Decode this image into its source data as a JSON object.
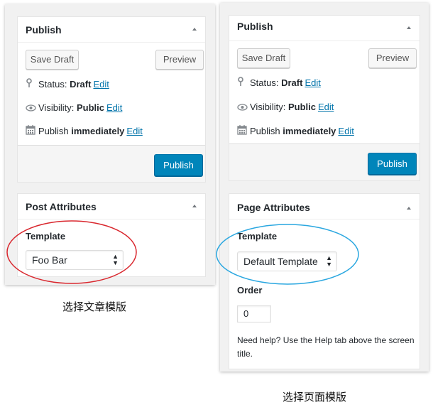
{
  "left": {
    "publish_box": {
      "title": "Publish",
      "save_draft": "Save Draft",
      "preview": "Preview",
      "status_label": "Status:",
      "status_value": "Draft",
      "visibility_label": "Visibility:",
      "visibility_value": "Public",
      "publish_label": "Publish",
      "publish_value": "immediately",
      "edit": "Edit",
      "publish_button": "Publish"
    },
    "attributes_box": {
      "title": "Post Attributes",
      "template_label": "Template",
      "template_value": "Foo Bar"
    },
    "caption": "选择文章模版"
  },
  "right": {
    "publish_box": {
      "title": "Publish",
      "save_draft": "Save Draft",
      "preview": "Preview",
      "status_label": "Status:",
      "status_value": "Draft",
      "visibility_label": "Visibility:",
      "visibility_value": "Public",
      "publish_label": "Publish",
      "publish_value": "immediately",
      "edit": "Edit",
      "publish_button": "Publish"
    },
    "attributes_box": {
      "title": "Page Attributes",
      "template_label": "Template",
      "template_value": "Default Template",
      "order_label": "Order",
      "order_value": "0",
      "help_text": "Need help? Use the Help tab above the screen title."
    },
    "caption": "选择页面模版"
  },
  "colors": {
    "primary_button": "#0085ba",
    "link": "#0073aa",
    "highlight_red": "#d9272e",
    "highlight_blue": "#2aa7e0"
  },
  "icons": {
    "status": "pin-icon",
    "visibility": "eye-icon",
    "publish": "calendar-icon",
    "collapse": "triangle-up-icon",
    "select": "select-arrows-icon"
  }
}
